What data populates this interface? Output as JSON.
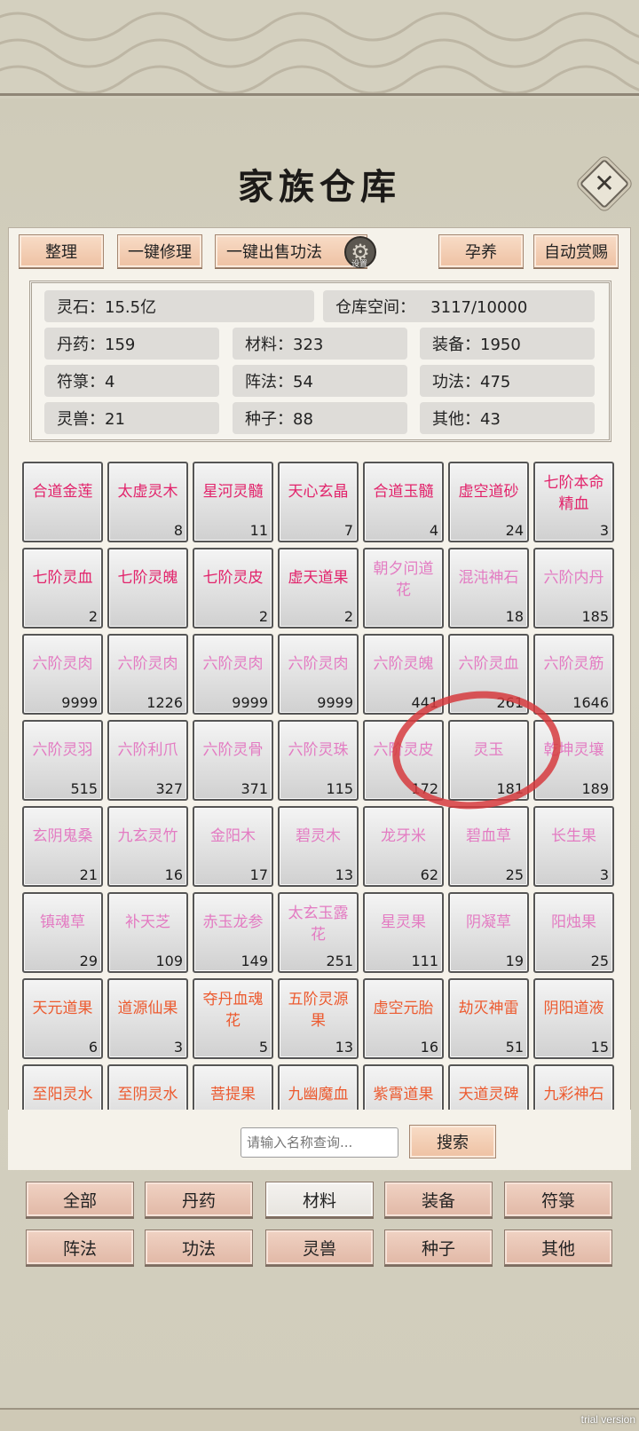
{
  "title": "家族仓库",
  "toolbar": {
    "tidy": "整理",
    "repair_all": "一键修理",
    "sell_all_skills": "一键出售功法",
    "gear_label": "设置",
    "incubate": "孕养",
    "auto_reward": "自动赏赐"
  },
  "stats": {
    "spirit_stone": "灵石：15.5亿",
    "space": "仓库空间：   3117/10000",
    "pill": "丹药：159",
    "material": "材料：323",
    "equipment": "装备：1950",
    "talisman": "符箓：4",
    "formation": "阵法：54",
    "skill": "功法：475",
    "beast": "灵兽：21",
    "seed": "种子：88",
    "other": "其他：43"
  },
  "items": [
    {
      "name": "合道金莲",
      "count": "",
      "color": "#e2236b"
    },
    {
      "name": "太虚灵木",
      "count": "8",
      "color": "#e2236b"
    },
    {
      "name": "星河灵髓",
      "count": "11",
      "color": "#e2236b"
    },
    {
      "name": "天心玄晶",
      "count": "7",
      "color": "#e2236b"
    },
    {
      "name": "合道玉髓",
      "count": "4",
      "color": "#e2236b"
    },
    {
      "name": "虚空道砂",
      "count": "24",
      "color": "#e2236b"
    },
    {
      "name": "七阶本命精血",
      "count": "3",
      "color": "#e2236b"
    },
    {
      "name": "七阶灵血",
      "count": "2",
      "color": "#e2236b"
    },
    {
      "name": "七阶灵魄",
      "count": "",
      "color": "#e2236b"
    },
    {
      "name": "七阶灵皮",
      "count": "2",
      "color": "#e2236b"
    },
    {
      "name": "虚天道果",
      "count": "2",
      "color": "#e2236b"
    },
    {
      "name": "朝夕问道花",
      "count": "",
      "color": "#e37bc2"
    },
    {
      "name": "混沌神石",
      "count": "18",
      "color": "#e37bc2"
    },
    {
      "name": "六阶内丹",
      "count": "185",
      "color": "#e37bc2"
    },
    {
      "name": "六阶灵肉",
      "count": "9999",
      "color": "#e37bc2"
    },
    {
      "name": "六阶灵肉",
      "count": "1226",
      "color": "#e37bc2"
    },
    {
      "name": "六阶灵肉",
      "count": "9999",
      "color": "#e37bc2"
    },
    {
      "name": "六阶灵肉",
      "count": "9999",
      "color": "#e37bc2"
    },
    {
      "name": "六阶灵魄",
      "count": "441",
      "color": "#e37bc2"
    },
    {
      "name": "六阶灵血",
      "count": "261",
      "color": "#e37bc2"
    },
    {
      "name": "六阶灵筋",
      "count": "1646",
      "color": "#e37bc2"
    },
    {
      "name": "六阶灵羽",
      "count": "515",
      "color": "#e37bc2"
    },
    {
      "name": "六阶利爪",
      "count": "327",
      "color": "#e37bc2"
    },
    {
      "name": "六阶灵骨",
      "count": "371",
      "color": "#e37bc2"
    },
    {
      "name": "六阶灵珠",
      "count": "115",
      "color": "#e37bc2"
    },
    {
      "name": "六阶灵皮",
      "count": "172",
      "color": "#e37bc2"
    },
    {
      "name": "灵玉",
      "count": "181",
      "color": "#e37bc2"
    },
    {
      "name": "乾坤灵壤",
      "count": "189",
      "color": "#e37bc2"
    },
    {
      "name": "玄阴鬼桑",
      "count": "21",
      "color": "#e37bc2"
    },
    {
      "name": "九玄灵竹",
      "count": "16",
      "color": "#e37bc2"
    },
    {
      "name": "金阳木",
      "count": "17",
      "color": "#e37bc2"
    },
    {
      "name": "碧灵木",
      "count": "13",
      "color": "#e37bc2"
    },
    {
      "name": "龙牙米",
      "count": "62",
      "color": "#e37bc2"
    },
    {
      "name": "碧血草",
      "count": "25",
      "color": "#e37bc2"
    },
    {
      "name": "长生果",
      "count": "3",
      "color": "#e37bc2"
    },
    {
      "name": "镇魂草",
      "count": "29",
      "color": "#e37bc2"
    },
    {
      "name": "补天芝",
      "count": "109",
      "color": "#e37bc2"
    },
    {
      "name": "赤玉龙参",
      "count": "149",
      "color": "#e37bc2"
    },
    {
      "name": "太玄玉露花",
      "count": "251",
      "color": "#e37bc2"
    },
    {
      "name": "星灵果",
      "count": "111",
      "color": "#e37bc2"
    },
    {
      "name": "阴凝草",
      "count": "19",
      "color": "#e37bc2"
    },
    {
      "name": "阳烛果",
      "count": "25",
      "color": "#e37bc2"
    },
    {
      "name": "天元道果",
      "count": "6",
      "color": "#ec5a2f"
    },
    {
      "name": "道源仙果",
      "count": "3",
      "color": "#ec5a2f"
    },
    {
      "name": "夺丹血魂花",
      "count": "5",
      "color": "#ec5a2f"
    },
    {
      "name": "五阶灵源果",
      "count": "13",
      "color": "#ec5a2f"
    },
    {
      "name": "虚空元胎",
      "count": "16",
      "color": "#ec5a2f"
    },
    {
      "name": "劫灭神雷",
      "count": "51",
      "color": "#ec5a2f"
    },
    {
      "name": "阴阳道液",
      "count": "15",
      "color": "#ec5a2f"
    },
    {
      "name": "至阳灵水",
      "count": "",
      "color": "#ec5a2f"
    },
    {
      "name": "至阴灵水",
      "count": "",
      "color": "#ec5a2f"
    },
    {
      "name": "菩提果",
      "count": "",
      "color": "#ec5a2f"
    },
    {
      "name": "九幽魔血",
      "count": "",
      "color": "#ec5a2f"
    },
    {
      "name": "紫霄道果",
      "count": "",
      "color": "#ec5a2f"
    },
    {
      "name": "天道灵碑",
      "count": "",
      "color": "#ec5a2f"
    },
    {
      "name": "九彩神石",
      "count": "",
      "color": "#ec5a2f"
    }
  ],
  "search": {
    "placeholder": "请输入名称查询...",
    "button": "搜索"
  },
  "tabs": [
    "全部",
    "丹药",
    "材料",
    "装备",
    "符箓",
    "阵法",
    "功法",
    "灵兽",
    "种子",
    "其他"
  ],
  "active_tab": "材料",
  "watermark": "trial version"
}
